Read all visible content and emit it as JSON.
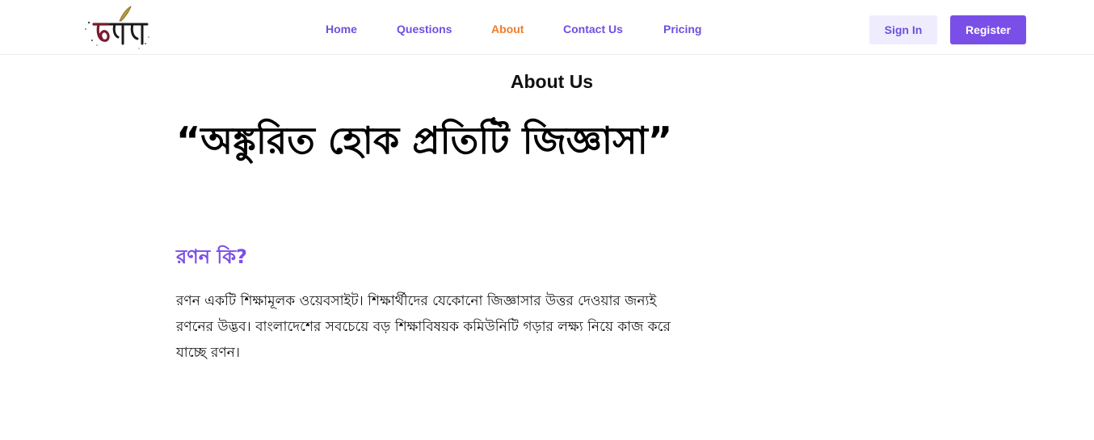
{
  "navbar": {
    "logo_text": "রণন",
    "links": [
      {
        "label": "Home",
        "active": false
      },
      {
        "label": "Questions",
        "active": false
      },
      {
        "label": "About",
        "active": true
      },
      {
        "label": "Contact Us",
        "active": false
      },
      {
        "label": "Pricing",
        "active": false
      }
    ],
    "sign_in_label": "Sign In",
    "register_label": "Register"
  },
  "colors": {
    "accent": "#7a4fe8",
    "active_link": "#f07c2a",
    "signin_bg": "#efedfd"
  },
  "main": {
    "title": "About Us",
    "tagline": "“অঙ্কুরিত হোক প্রতিটি জিজ্ঞাসা”",
    "section_heading": "রণন কি?",
    "section_body": "রণন একটি শিক্ষামূলক ওয়েবসাইট। শিক্ষার্থীদের যেকোনো জিজ্ঞাসার উত্তর দেওয়ার জন্যই রণনের উদ্ভব। বাংলাদেশের সবচেয়ে বড় শিক্ষাবিষয়ক কমিউনিটি গড়ার লক্ষ্য নিয়ে কাজ করে যাচ্ছে রণন।"
  }
}
